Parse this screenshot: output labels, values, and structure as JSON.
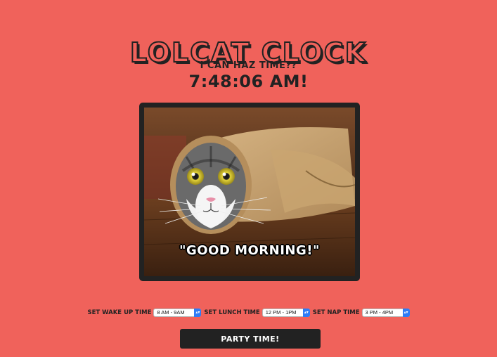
{
  "header": {
    "title": "LOLCAT CLOCK",
    "subtitle": "I CAN HAZ TIME??",
    "clock": "7:48:06 AM!"
  },
  "photo": {
    "caption": "\"GOOD MORNING!\""
  },
  "controls": {
    "wake_label": "SET WAKE UP TIME",
    "wake_value": "8 AM - 9AM",
    "lunch_label": "SET LUNCH TIME",
    "lunch_value": "12 PM - 1PM",
    "nap_label": "SET NAP TIME",
    "nap_value": "3 PM - 4PM",
    "party_button": "PARTY TIME!"
  },
  "colors": {
    "background": "#f0625b",
    "text": "#222222",
    "button": "#222222",
    "select_arrow": "#2f7cf6"
  },
  "icons": {
    "select_arrow": "chevron-up-down-icon"
  }
}
